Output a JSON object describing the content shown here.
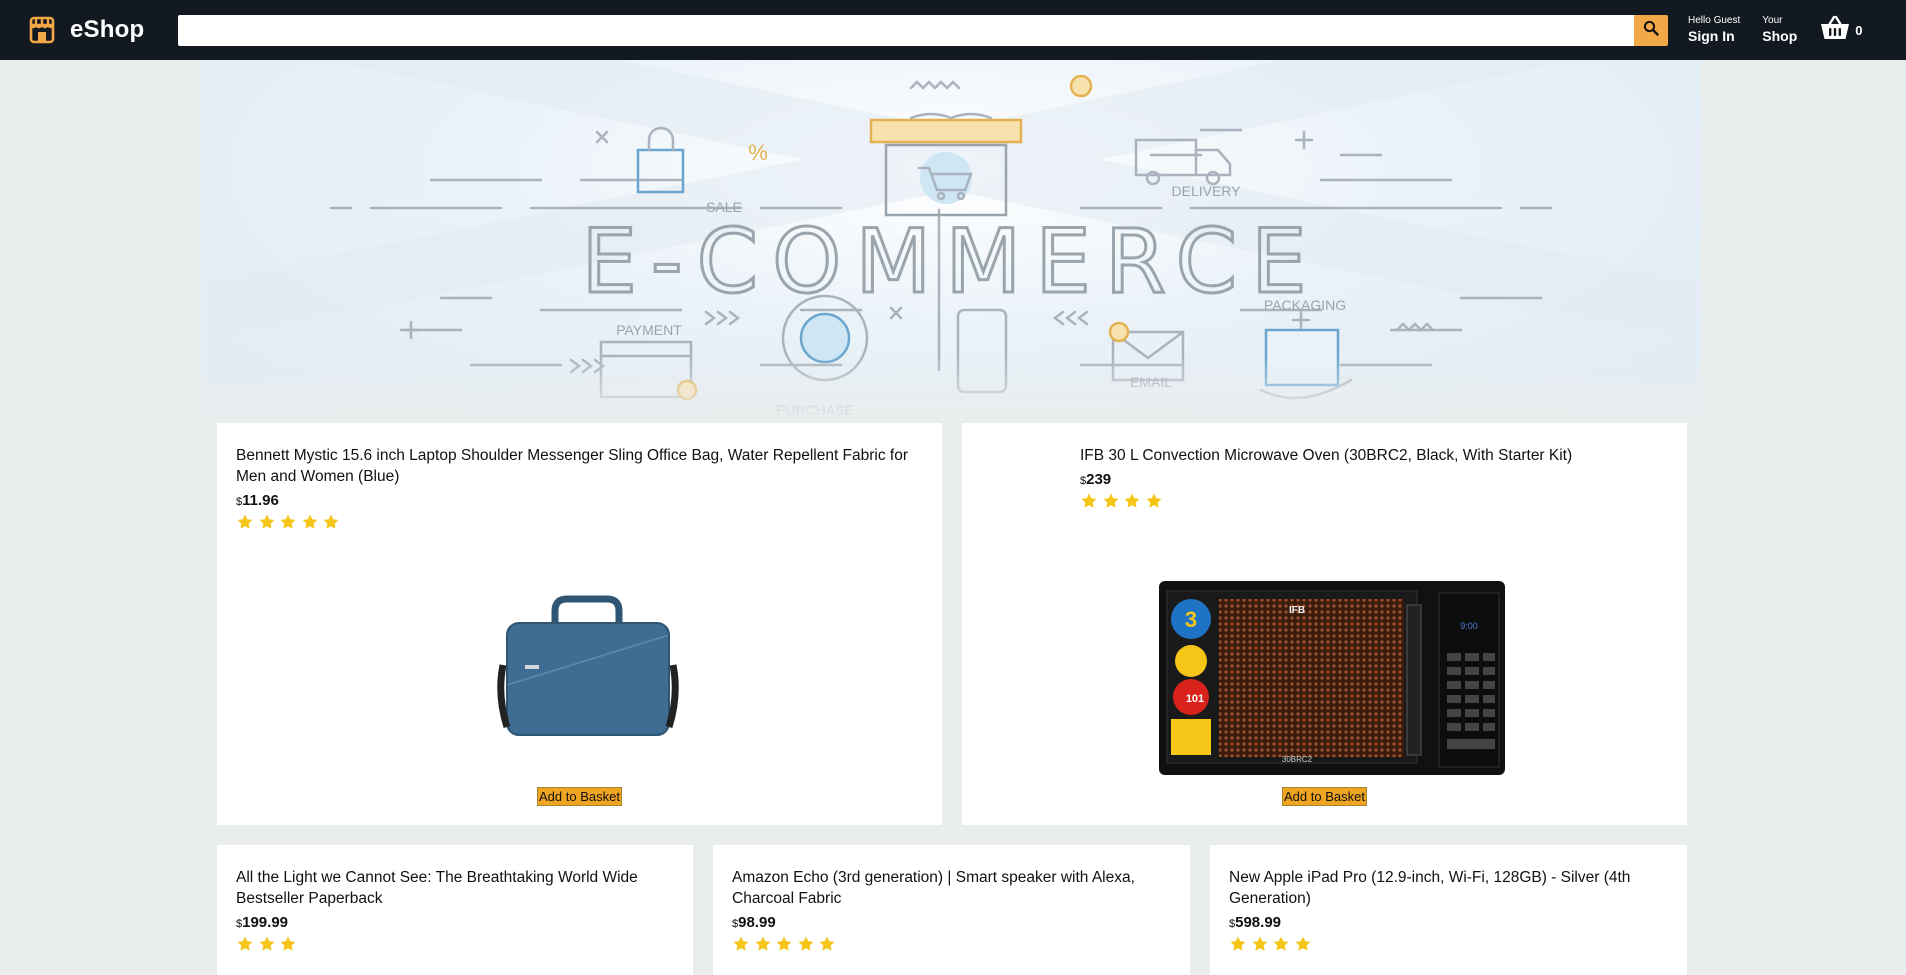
{
  "header": {
    "logo_text": "eShop",
    "search_placeholder": "",
    "nav": [
      {
        "line1": "Hello Guest",
        "line2": "Sign In"
      },
      {
        "line1": "Your",
        "line2": "Shop"
      }
    ],
    "basket_count": "0"
  },
  "hero": {
    "alt": "E-COMMERCE",
    "labels": {
      "sale": "SALE",
      "delivery": "DELIVERY",
      "payment": "PAYMENT",
      "packaging": "PACKAGING",
      "purchase": "PURCHASE",
      "email": "EMAIL",
      "percent": "%"
    }
  },
  "products": [
    {
      "title": "Bennett Mystic 15.6 inch Laptop Shoulder Messenger Sling Office Bag, Water Repellent Fabric for Men and Women (Blue)",
      "currency": "$",
      "price": "11.96",
      "rating": 5,
      "button": "Add to Basket"
    },
    {
      "title": "IFB 30 L Convection Microwave Oven (30BRC2, Black, With Starter Kit)",
      "currency": "$",
      "price": "239",
      "rating": 4,
      "button": "Add to Basket",
      "image_brand": "IFB",
      "image_model": "30BRC2",
      "image_display": "9:00",
      "image_sticker": "3",
      "image_sticker_small": "101"
    },
    {
      "title": "All the Light we Cannot See: The Breathtaking World Wide Bestseller Paperback",
      "currency": "$",
      "price": "199.99",
      "rating": 3
    },
    {
      "title": "Amazon Echo (3rd generation) | Smart speaker with Alexa, Charcoal Fabric",
      "currency": "$",
      "price": "98.99",
      "rating": 5
    },
    {
      "title": "New Apple iPad Pro (12.9-inch, Wi-Fi, 128GB) - Silver (4th Generation)",
      "currency": "$",
      "price": "598.99",
      "rating": 4
    }
  ],
  "colors": {
    "header_bg": "#131921",
    "accent": "#f3a847",
    "star": "#f5c518",
    "button": "#f0a522",
    "page_bg": "#eaeded"
  }
}
